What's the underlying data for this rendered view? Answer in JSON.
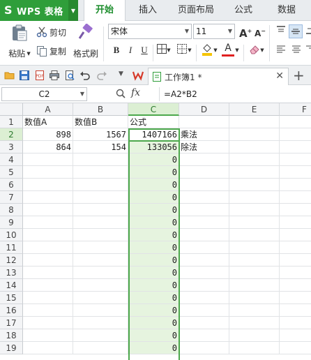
{
  "app": {
    "name": "WPS 表格",
    "logo": "S"
  },
  "menu": {
    "tabs": [
      "开始",
      "插入",
      "页面布局",
      "公式",
      "数据"
    ],
    "active": "开始"
  },
  "ribbon": {
    "paste": "粘贴",
    "cut": "剪切",
    "copy": "复制",
    "format_painter": "格式刷",
    "font_name": "宋体",
    "font_size": "11",
    "bold": "B",
    "italic": "I",
    "underline": "U",
    "grow_font": "A⁺",
    "shrink_font": "A⁻",
    "font_color_accent": "#e02020",
    "fill_color_accent": "#f5c400"
  },
  "doc": {
    "tab_title": "工作簿1 *"
  },
  "formula_bar": {
    "name_box": "C2",
    "fx": "fx",
    "formula": "=A2*B2"
  },
  "sheet": {
    "columns": [
      "A",
      "B",
      "C",
      "D",
      "E",
      "F"
    ],
    "selected_column": "C",
    "rows": [
      {
        "n": "1",
        "a": "数值A",
        "b": "数值B",
        "c": "公式",
        "d": ""
      },
      {
        "n": "2",
        "a": "898",
        "b": "1567",
        "c": "1407166",
        "d": "乘法"
      },
      {
        "n": "3",
        "a": "864",
        "b": "154",
        "c": "133056",
        "d": "除法"
      },
      {
        "n": "4",
        "a": "",
        "b": "",
        "c": "0",
        "d": ""
      },
      {
        "n": "5",
        "a": "",
        "b": "",
        "c": "0",
        "d": ""
      },
      {
        "n": "6",
        "a": "",
        "b": "",
        "c": "0",
        "d": ""
      },
      {
        "n": "7",
        "a": "",
        "b": "",
        "c": "0",
        "d": ""
      },
      {
        "n": "8",
        "a": "",
        "b": "",
        "c": "0",
        "d": ""
      },
      {
        "n": "9",
        "a": "",
        "b": "",
        "c": "0",
        "d": ""
      },
      {
        "n": "10",
        "a": "",
        "b": "",
        "c": "0",
        "d": ""
      },
      {
        "n": "11",
        "a": "",
        "b": "",
        "c": "0",
        "d": ""
      },
      {
        "n": "12",
        "a": "",
        "b": "",
        "c": "0",
        "d": ""
      },
      {
        "n": "13",
        "a": "",
        "b": "",
        "c": "0",
        "d": ""
      },
      {
        "n": "14",
        "a": "",
        "b": "",
        "c": "0",
        "d": ""
      },
      {
        "n": "15",
        "a": "",
        "b": "",
        "c": "0",
        "d": ""
      },
      {
        "n": "16",
        "a": "",
        "b": "",
        "c": "0",
        "d": ""
      },
      {
        "n": "17",
        "a": "",
        "b": "",
        "c": "0",
        "d": ""
      },
      {
        "n": "18",
        "a": "",
        "b": "",
        "c": "0",
        "d": ""
      },
      {
        "n": "19",
        "a": "",
        "b": "",
        "c": "0",
        "d": ""
      }
    ]
  },
  "colors": {
    "accent_green": "#2f9e3a",
    "selection_border": "#4ca84c",
    "selection_fill": "#e6f4df"
  }
}
